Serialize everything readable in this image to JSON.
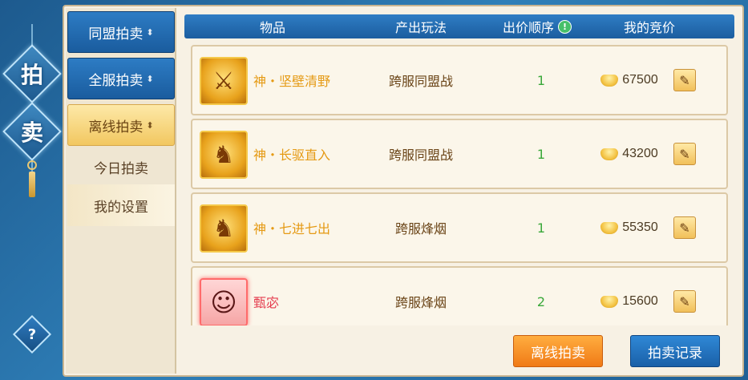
{
  "side_title": [
    "拍",
    "卖"
  ],
  "help_label": "?",
  "sidebar": {
    "tabs": [
      {
        "label": "同盟拍卖",
        "chev": "⬍"
      },
      {
        "label": "全服拍卖",
        "chev": "⬍"
      },
      {
        "label": "离线拍卖",
        "chev": "⬍"
      },
      {
        "label": "今日拍卖"
      },
      {
        "label": "我的设置"
      }
    ]
  },
  "table": {
    "headers": {
      "item": "物品",
      "mode": "产出玩法",
      "order": "出价顺序",
      "bid": "我的竞价",
      "info_icon": "!"
    },
    "rows": [
      {
        "icon": "shield-warrior-icon",
        "glyph": "⚔",
        "name": "神・坚壁清野",
        "name_color": "gold",
        "mode": "跨服同盟战",
        "order": "1",
        "price": "67500"
      },
      {
        "icon": "cavalry-charge-icon",
        "glyph": "♞",
        "name": "神・长驱直入",
        "name_color": "gold",
        "mode": "跨服同盟战",
        "order": "1",
        "price": "43200"
      },
      {
        "icon": "cavalry-charge-icon",
        "glyph": "♞",
        "name": "神・七进七出",
        "name_color": "gold",
        "mode": "跨服烽烟",
        "order": "1",
        "price": "55350"
      },
      {
        "icon": "hero-portrait-icon",
        "glyph": "☺",
        "name": "甄宓",
        "name_color": "red",
        "mode": "跨服烽烟",
        "order": "2",
        "price": "15600"
      }
    ]
  },
  "footer": {
    "offline_button": "离线拍卖",
    "record_button": "拍卖记录"
  }
}
